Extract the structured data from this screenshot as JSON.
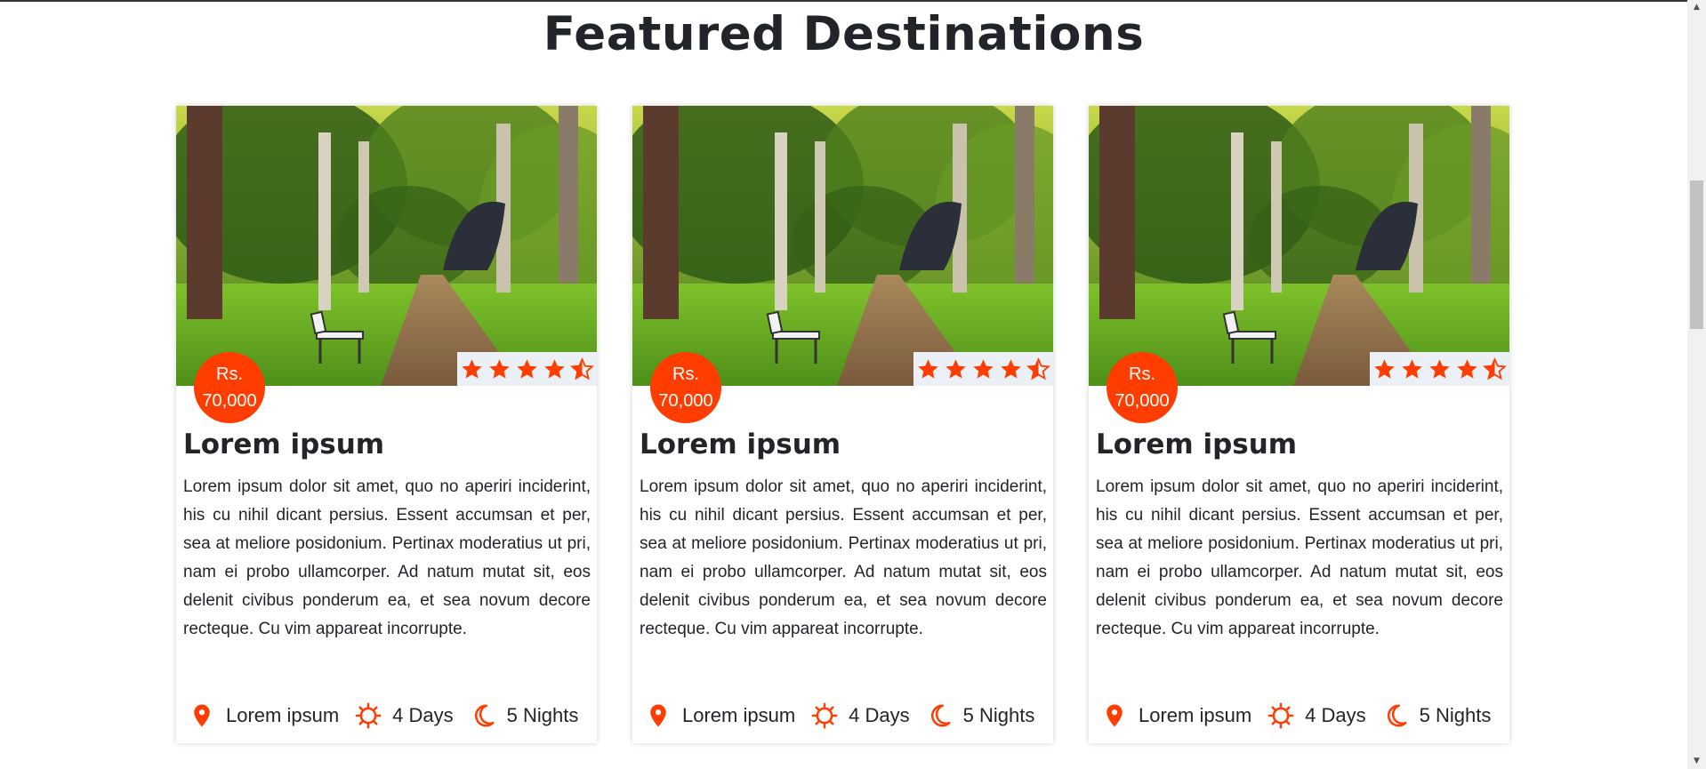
{
  "section": {
    "title": "Featured Destinations"
  },
  "cards": [
    {
      "price_currency": "Rs.",
      "price_amount": "70,000",
      "rating": 4.5,
      "title": "Lorem ipsum",
      "description": "Lorem ipsum dolor sit amet, quo no aperiri inciderint, his cu nihil dicant persius. Essent accumsan et per, sea at meliore posidonium. Pertinax moderatius ut pri, nam ei probo ullamcorper. Ad natum mutat sit, eos delenit civibus ponderum ea, et sea novum decore recteque. Cu vim appareat incorrupte.",
      "location": "Lorem ipsum",
      "days": "4 Days",
      "nights": "5 Nights"
    },
    {
      "price_currency": "Rs.",
      "price_amount": "70,000",
      "rating": 4.5,
      "title": "Lorem ipsum",
      "description": "Lorem ipsum dolor sit amet, quo no aperiri inciderint, his cu nihil dicant persius. Essent accumsan et per, sea at meliore posidonium. Pertinax moderatius ut pri, nam ei probo ullamcorper. Ad natum mutat sit, eos delenit civibus ponderum ea, et sea novum decore recteque. Cu vim appareat incorrupte.",
      "location": "Lorem ipsum",
      "days": "4 Days",
      "nights": "5 Nights"
    },
    {
      "price_currency": "Rs.",
      "price_amount": "70,000",
      "rating": 4.5,
      "title": "Lorem ipsum",
      "description": "Lorem ipsum dolor sit amet, quo no aperiri inciderint, his cu nihil dicant persius. Essent accumsan et per, sea at meliore posidonium. Pertinax moderatius ut pri, nam ei probo ullamcorper. Ad natum mutat sit, eos delenit civibus ponderum ea, et sea novum decore recteque. Cu vim appareat incorrupte.",
      "location": "Lorem ipsum",
      "days": "4 Days",
      "nights": "5 Nights"
    }
  ],
  "icons": {
    "location": "map-marker-icon",
    "days": "sun-icon",
    "nights": "moon-icon",
    "rating": "star-icon"
  },
  "colors": {
    "accent": "#ff3d00",
    "rating_bg": "#eaf0f6",
    "heading": "#212529"
  }
}
